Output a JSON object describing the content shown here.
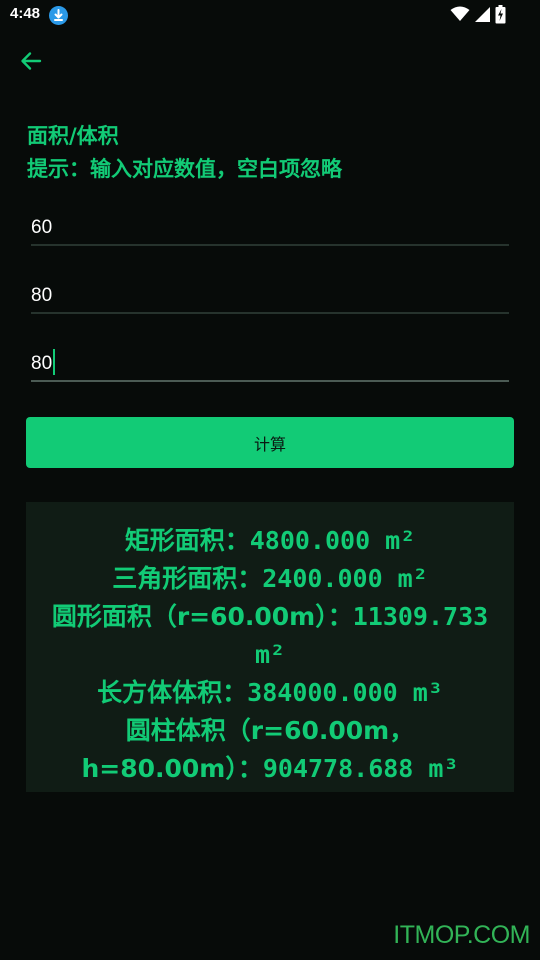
{
  "status_bar": {
    "time": "4:48",
    "icons": [
      "download-icon",
      "wifi-icon",
      "signal-icon",
      "battery-charging-icon"
    ]
  },
  "toolbar": {
    "back_icon": "arrow-left-icon"
  },
  "header": {
    "title": "面积/体积",
    "hint": "提示：输入对应数值，空白项忽略"
  },
  "inputs": [
    {
      "value": "60"
    },
    {
      "value": "80"
    },
    {
      "value": "80"
    }
  ],
  "calc_button": {
    "label": "计算"
  },
  "results": {
    "lines": [
      {
        "label": "矩形面积：",
        "value": "4800.000 m²"
      },
      {
        "label": "三角形面积：",
        "value": "2400.000 m²"
      },
      {
        "label": "圆形面积（r=60.00m）：",
        "value": "11309.733 m²"
      },
      {
        "label": "长方体体积：",
        "value": "384000.000 m³"
      },
      {
        "label": "圆柱体积（r=60.00m，h=80.00m）：",
        "value": "904778.688 m³"
      }
    ]
  },
  "watermark": "ITMOP.COM",
  "colors": {
    "accent": "#12cb76",
    "background": "#070b09",
    "panel": "#101c15"
  }
}
